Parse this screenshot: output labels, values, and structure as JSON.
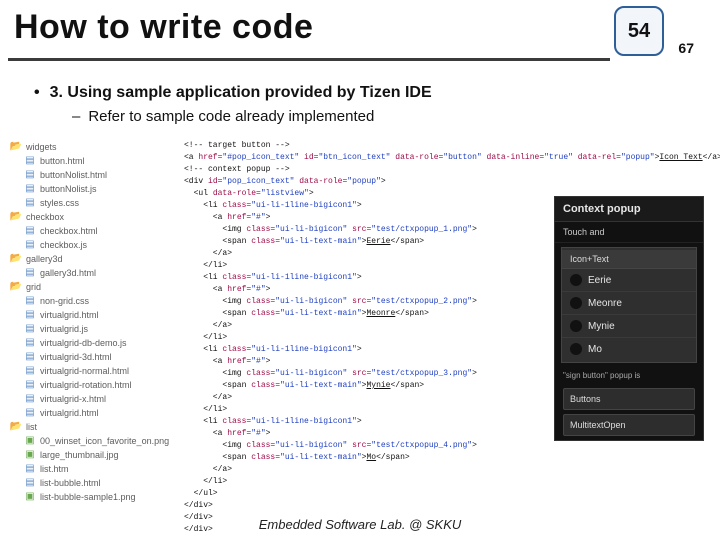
{
  "slide": {
    "title": "How to write code",
    "page_current": "54",
    "page_total": "67",
    "footer": "Embedded Software Lab. @ SKKU"
  },
  "bullets": {
    "level1_prefix": "•",
    "level1": "3. Using sample application provided by Tizen IDE",
    "level2_prefix": "–",
    "level2": "Refer to sample code already implemented"
  },
  "tree": [
    {
      "type": "folder-open",
      "level": 1,
      "name": "widgets"
    },
    {
      "type": "file-page",
      "level": 2,
      "name": "button.html"
    },
    {
      "type": "file-page",
      "level": 2,
      "name": "buttonNolist.html"
    },
    {
      "type": "file-page",
      "level": 2,
      "name": "buttonNolist.js"
    },
    {
      "type": "file-page",
      "level": 2,
      "name": "styles.css"
    },
    {
      "type": "folder-open",
      "level": 1,
      "name": "checkbox"
    },
    {
      "type": "file-page",
      "level": 2,
      "name": "checkbox.html"
    },
    {
      "type": "file-page",
      "level": 2,
      "name": "checkbox.js"
    },
    {
      "type": "folder-open",
      "level": 1,
      "name": "gallery3d"
    },
    {
      "type": "file-page",
      "level": 2,
      "name": "gallery3d.html"
    },
    {
      "type": "folder-open",
      "level": 1,
      "name": "grid"
    },
    {
      "type": "file-page",
      "level": 2,
      "name": "non-grid.css"
    },
    {
      "type": "file-page",
      "level": 2,
      "name": "virtualgrid.html"
    },
    {
      "type": "file-page",
      "level": 2,
      "name": "virtualgrid.js"
    },
    {
      "type": "file-page",
      "level": 2,
      "name": "virtualgrid-db-demo.js"
    },
    {
      "type": "file-page",
      "level": 2,
      "name": "virtualgrid-3d.html"
    },
    {
      "type": "file-page",
      "level": 2,
      "name": "virtualgrid-normal.html"
    },
    {
      "type": "file-page",
      "level": 2,
      "name": "virtualgrid-rotation.html"
    },
    {
      "type": "file-page",
      "level": 2,
      "name": "virtualgrid-x.html"
    },
    {
      "type": "file-page",
      "level": 2,
      "name": "virtualgrid.html"
    },
    {
      "type": "folder-open",
      "level": 1,
      "name": "list"
    },
    {
      "type": "file-img",
      "level": 2,
      "name": "00_winset_icon_favorite_on.png"
    },
    {
      "type": "file-img",
      "level": 2,
      "name": "large_thumbnail.jpg"
    },
    {
      "type": "file-page",
      "level": 2,
      "name": "list.htm"
    },
    {
      "type": "file-page",
      "level": 2,
      "name": "list-bubble.html"
    },
    {
      "type": "file-img",
      "level": 2,
      "name": "list-bubble-sample1.png"
    }
  ],
  "code_lines": [
    {
      "html": "&lt;!-- target button --&gt;",
      "cls": "c"
    },
    {
      "html": "&lt;a <span class='a'>href=</span><span class='s'>\"#pop_icon_text\"</span> <span class='a'>id=</span><span class='s'>\"btn_icon_text\"</span> <span class='a'>data-role=</span><span class='s'>\"button\"</span> <span class='a'>data-inline=</span><span class='s'>\"true\"</span> <span class='a'>data-rel=</span><span class='s'>\"popup\"</span>&gt;<span class='tx'>Icon Text</span>&lt;/a&gt;",
      "cls": "t"
    },
    {
      "html": "&lt;!-- context popup --&gt;",
      "cls": "c"
    },
    {
      "html": "&lt;div <span class='a'>id=</span><span class='s'>\"pop_icon_text\"</span> <span class='a'>data-role=</span><span class='s'>\"popup\"</span>&gt;",
      "cls": "t"
    },
    {
      "html": "  &lt;ul <span class='a'>data-role=</span><span class='s'>\"listview\"</span>&gt;",
      "cls": "t"
    },
    {
      "html": "    &lt;li <span class='a'>class=</span><span class='s'>\"ui-li-1line-bigicon1\"</span>&gt;",
      "cls": "t"
    },
    {
      "html": "      &lt;a <span class='a'>href=</span><span class='s'>\"#\"</span>&gt;",
      "cls": "t"
    },
    {
      "html": "        &lt;img <span class='a'>class=</span><span class='s'>\"ui-li-bigicon\"</span> <span class='a'>src=</span><span class='s'>\"test/ctxpopup_1.png\"</span>&gt;",
      "cls": "t"
    },
    {
      "html": "        &lt;span <span class='a'>class=</span><span class='s'>\"ui-li-text-main\"</span>&gt;<span class='tx'>Eerie</span>&lt;/span&gt;",
      "cls": "t"
    },
    {
      "html": "      &lt;/a&gt;",
      "cls": "t"
    },
    {
      "html": "    &lt;/li&gt;",
      "cls": "t"
    },
    {
      "html": "    &lt;li <span class='a'>class=</span><span class='s'>\"ui-li-1line-bigicon1\"</span>&gt;",
      "cls": "t"
    },
    {
      "html": "      &lt;a <span class='a'>href=</span><span class='s'>\"#\"</span>&gt;",
      "cls": "t"
    },
    {
      "html": "        &lt;img <span class='a'>class=</span><span class='s'>\"ui-li-bigicon\"</span> <span class='a'>src=</span><span class='s'>\"test/ctxpopup_2.png\"</span>&gt;",
      "cls": "t"
    },
    {
      "html": "        &lt;span <span class='a'>class=</span><span class='s'>\"ui-li-text-main\"</span>&gt;<span class='tx'>Meonre</span>&lt;/span&gt;",
      "cls": "t"
    },
    {
      "html": "      &lt;/a&gt;",
      "cls": "t"
    },
    {
      "html": "    &lt;/li&gt;",
      "cls": "t"
    },
    {
      "html": "    &lt;li <span class='a'>class=</span><span class='s'>\"ui-li-1line-bigicon1\"</span>&gt;",
      "cls": "t"
    },
    {
      "html": "      &lt;a <span class='a'>href=</span><span class='s'>\"#\"</span>&gt;",
      "cls": "t"
    },
    {
      "html": "        &lt;img <span class='a'>class=</span><span class='s'>\"ui-li-bigicon\"</span> <span class='a'>src=</span><span class='s'>\"test/ctxpopup_3.png\"</span>&gt;",
      "cls": "t"
    },
    {
      "html": "        &lt;span <span class='a'>class=</span><span class='s'>\"ui-li-text-main\"</span>&gt;<span class='tx'>Mynie</span>&lt;/span&gt;",
      "cls": "t"
    },
    {
      "html": "      &lt;/a&gt;",
      "cls": "t"
    },
    {
      "html": "    &lt;/li&gt;",
      "cls": "t"
    },
    {
      "html": "    &lt;li <span class='a'>class=</span><span class='s'>\"ui-li-1line-bigicon1\"</span>&gt;",
      "cls": "t"
    },
    {
      "html": "      &lt;a <span class='a'>href=</span><span class='s'>\"#\"</span>&gt;",
      "cls": "t"
    },
    {
      "html": "        &lt;img <span class='a'>class=</span><span class='s'>\"ui-li-bigicon\"</span> <span class='a'>src=</span><span class='s'>\"test/ctxpopup_4.png\"</span>&gt;",
      "cls": "t"
    },
    {
      "html": "        &lt;span <span class='a'>class=</span><span class='s'>\"ui-li-text-main\"</span>&gt;<span class='tx'>Mo</span>&lt;/span&gt;",
      "cls": "t"
    },
    {
      "html": "      &lt;/a&gt;",
      "cls": "t"
    },
    {
      "html": "    &lt;/li&gt;",
      "cls": "t"
    },
    {
      "html": "  &lt;/ul&gt;",
      "cls": "t"
    },
    {
      "html": "&lt;/div&gt;",
      "cls": "t"
    },
    {
      "html": "&lt;/div&gt;",
      "cls": "t"
    },
    {
      "html": "&lt;/div&gt;",
      "cls": "t"
    }
  ],
  "phone": {
    "header": "Context popup",
    "anchor": "Touch and",
    "submenu_head": "Icon+Text",
    "items": [
      "Eerie",
      "Meonre",
      "Mynie",
      "Mo"
    ],
    "note": "\"sign button\" popup is",
    "buttons": [
      "Buttons",
      "MultitextOpen"
    ]
  }
}
